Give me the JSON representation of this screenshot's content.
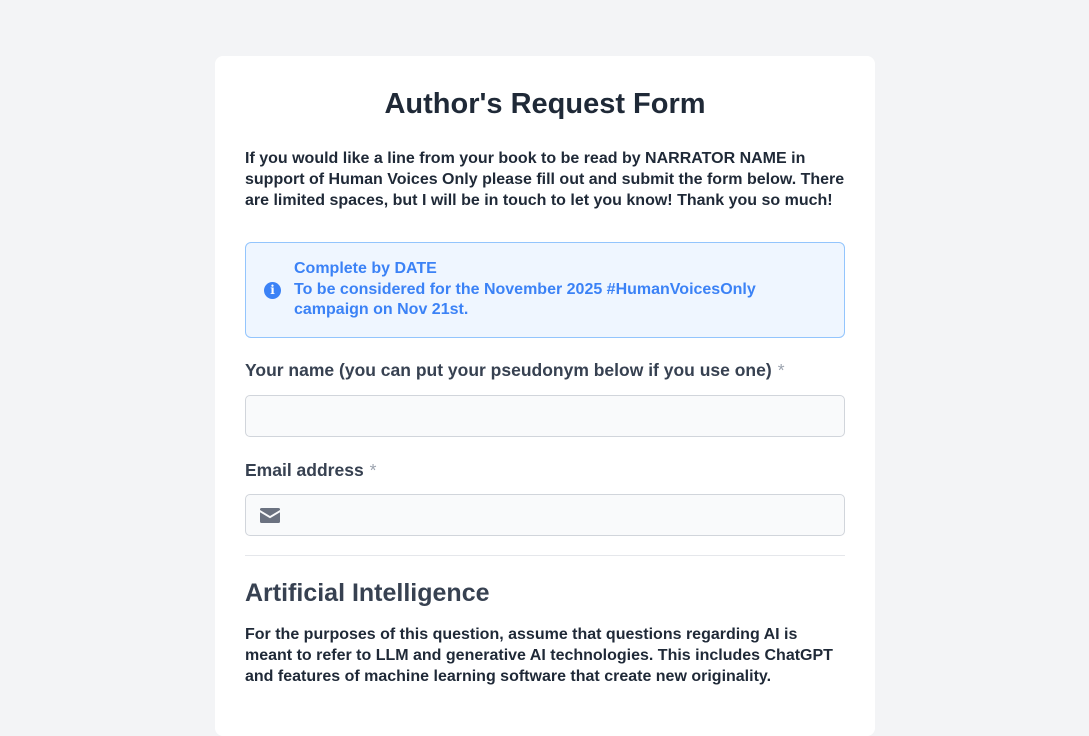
{
  "form": {
    "title": "Author's Request Form",
    "intro": "If you would like a line from your book to be read by NARRATOR NAME in support of Human Voices Only please fill out and submit the form below. There are limited spaces, but I will be in touch to let you know! Thank you so much!",
    "callout": {
      "icon": "info-icon",
      "line1": "Complete by DATE",
      "line2": "To be considered for the November 2025 #HumanVoicesOnly campaign on Nov 21st."
    },
    "name_field": {
      "label": "Your name (you can put your pseudonym below if you use one)",
      "required_mark": "*",
      "value": ""
    },
    "email_field": {
      "label": "Email address",
      "required_mark": "*",
      "icon": "envelope-icon",
      "value": ""
    },
    "ai_section": {
      "title": "Artificial Intelligence",
      "description": "For the purposes of this question, assume that questions regarding AI is meant to refer to LLM and generative AI technologies. This includes ChatGPT and features of machine learning software that create new originality."
    }
  },
  "colors": {
    "accent": "#3b82f6",
    "callout_bg": "#eff6ff",
    "callout_border": "#93c5fd",
    "page_bg": "#f3f4f6"
  }
}
